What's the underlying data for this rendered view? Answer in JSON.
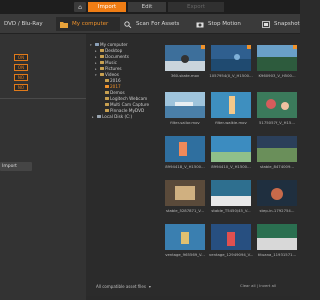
{
  "modes": {
    "home_label": "⌂",
    "import": "Import",
    "edit": "Edit",
    "export": "Export"
  },
  "sources": {
    "dvd": "DVD / Blu-Ray",
    "my_computer": "My computer",
    "scan": "Scan For Assets",
    "stop_motion": "Stop Motion",
    "snapshot": "Snapshot"
  },
  "left_panel": {
    "orange_buttons": [
      "ON",
      "ON",
      "NO",
      "NO"
    ],
    "import_button": "Import"
  },
  "tree": [
    {
      "label": "My computer",
      "level": 0
    },
    {
      "label": "Desktop",
      "level": 1
    },
    {
      "label": "Documents",
      "level": 1
    },
    {
      "label": "Music",
      "level": 1
    },
    {
      "label": "Pictures",
      "level": 1
    },
    {
      "label": "Videos",
      "level": 1
    },
    {
      "label": "2016",
      "level": 2
    },
    {
      "label": "2017",
      "level": 2
    },
    {
      "label": "Demos",
      "level": 2
    },
    {
      "label": "Logitech Webcam",
      "level": 2
    },
    {
      "label": "Multi Cam Capture",
      "level": 2
    },
    {
      "label": "Pinnacle MyDVD",
      "level": 2
    },
    {
      "label": "Local Disk (C:)",
      "level": 1
    }
  ],
  "thumbnails": [
    {
      "caption": "360-skate.mov",
      "bg": "#3d6f9b",
      "accent": "#e9f0f6",
      "checked": true
    },
    {
      "caption": "1057954(0_V_H1500...",
      "bg": "#2f5f8f",
      "accent": "#7fb0d8",
      "checked": true
    },
    {
      "caption": "K960903_V_H500...",
      "bg": "#2d5b3d",
      "accent": "#6aa0c8",
      "checked": true
    },
    {
      "caption": "filter-sailor.mov",
      "bg": "#4a7fa8",
      "accent": "#d8e6f0",
      "checked": false
    },
    {
      "caption": "filter-walkie.mov",
      "bg": "#3e8fbf",
      "accent": "#f5c98a",
      "checked": false
    },
    {
      "caption": "5175057f_V_H15...",
      "bg": "#3b7a5b",
      "accent": "#d65c5c",
      "checked": false
    },
    {
      "caption": "8994418_V_H1500...",
      "bg": "#2f6f9f",
      "accent": "#f08a5a",
      "checked": false
    },
    {
      "caption": "8994410_V_H1500...",
      "bg": "#3c8cc0",
      "accent": "#8fc08a",
      "checked": false
    },
    {
      "caption": "stable_8474009...",
      "bg": "#2b3f5a",
      "accent": "#6a8f5a",
      "checked": false
    },
    {
      "caption": "stable_5287871_V...",
      "bg": "#5a4a3a",
      "accent": "#d0b080",
      "checked": false
    },
    {
      "caption": "stable_T5450/45_V...",
      "bg": "#2e6f8f",
      "accent": "#e8e8e8",
      "checked": false
    },
    {
      "caption": "step-in-1792754...",
      "bg": "#1f2f3f",
      "accent": "#c86a4a",
      "checked": false
    },
    {
      "caption": "ventage_965569_V...",
      "bg": "#3a7fb0",
      "accent": "#e0c070",
      "checked": false
    },
    {
      "caption": "ventage_12949094_V...",
      "bg": "#274f80",
      "accent": "#e05050",
      "checked": false
    },
    {
      "caption": "tituana_11931571...",
      "bg": "#2a6f50",
      "accent": "#d8d8d8",
      "checked": false
    }
  ],
  "footer": {
    "all_compatible": "All compatible asset files",
    "clear_invert": "Clear all | Invert all"
  },
  "colors": {
    "accent": "#f07d14",
    "background": "#2b2b2b"
  }
}
